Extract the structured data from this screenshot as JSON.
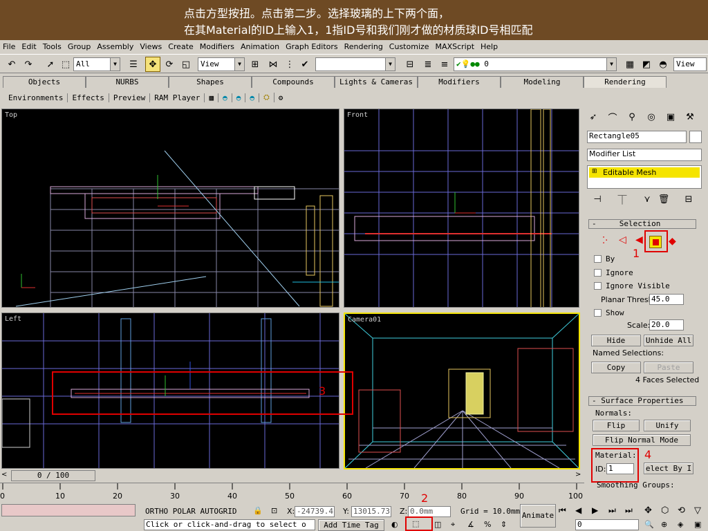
{
  "banner": {
    "line1": "点击方型按扭。点击第二步。选择玻璃的上下两个面，",
    "line2": "在其Material的ID上输入1，1指ID号和我们刚才做的材质球ID号相匹配"
  },
  "menu": [
    "File",
    "Edit",
    "Tools",
    "Group",
    "Assembly",
    "Views",
    "Create",
    "Modifiers",
    "Animation",
    "Graph Editors",
    "Rendering",
    "Customize",
    "MAXScript",
    "Help"
  ],
  "toolbar": {
    "selection_filter": "All",
    "ref_coord": "View",
    "named_selection": "",
    "layer": "0",
    "render_view": "View"
  },
  "tabs": [
    "Objects",
    "NURBS",
    "Shapes",
    "Compounds",
    "Lights & Cameras",
    "Modifiers",
    "Modeling",
    "Rendering"
  ],
  "subtabs": [
    "Environments",
    "Effects",
    "Preview",
    "RAM Player"
  ],
  "viewports": {
    "top": "Top",
    "front": "Front",
    "left": "Left",
    "camera": "Camera01"
  },
  "panel": {
    "object_name": "Rectangle05",
    "modifier_list": "Modifier List",
    "stack_item": "Editable Mesh",
    "selection_rollout": "Selection",
    "by_vertex": "By",
    "ignore_backfaces": "Ignore",
    "ignore_visible": "Ignore Visible",
    "planar_thresh_label": "Planar Thresh:",
    "planar_thresh": "45.0",
    "show_normals": "Show",
    "scale_label": "Scale:",
    "scale": "20.0",
    "hide": "Hide",
    "unhide_all": "Unhide All",
    "named_selections": "Named Selections:",
    "copy": "Copy",
    "paste": "Paste",
    "faces_selected": "4 Faces Selected",
    "surface_rollout": "Surface Properties",
    "normals_label": "Normals:",
    "flip": "Flip",
    "unify": "Unify",
    "flip_normal_mode": "Flip Normal Mode",
    "material_label": "Material:",
    "id_label": "ID:",
    "id_value": "1",
    "select_by_id": "elect By I",
    "smoothing_groups": "Smoothing Groups:"
  },
  "annotations": {
    "n1": "1",
    "n2": "2",
    "n3": "3",
    "n4": "4",
    "accent": "#e00000"
  },
  "timeline": {
    "frame": "0 / 100",
    "ticks": [
      "0",
      "10",
      "20",
      "30",
      "40",
      "50",
      "60",
      "70",
      "80",
      "90",
      "100"
    ]
  },
  "status": {
    "snaps": "ORTHO  POLAR  AUTOGRID",
    "x_label": "X:",
    "x_value": "-24739.4",
    "y_label": "Y:",
    "y_value": "13015.73",
    "z_label": "Z:",
    "z_value": "0.0mm",
    "grid": "Grid = 10.0mm",
    "prompt": "Click or click-and-drag to select o",
    "add_time_tag": "Add Time Tag",
    "animate": "Animate",
    "frame_field": "0"
  }
}
